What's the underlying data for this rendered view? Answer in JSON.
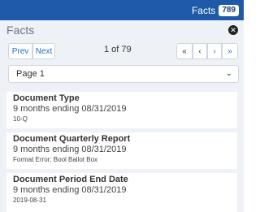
{
  "topbar": {
    "facts_label": "Facts",
    "facts_count": "789"
  },
  "panel": {
    "title": "Facts",
    "prev_label": "Prev",
    "next_label": "Next",
    "page_counter": "1 of 79",
    "nav_first": "«",
    "nav_prev": "‹",
    "nav_next": "›",
    "nav_last": "»",
    "page_select": "Page 1"
  },
  "facts": [
    {
      "name": "Document Type",
      "period": "9 months ending 08/31/2019",
      "value": "10-Q"
    },
    {
      "name": "Document Quarterly Report",
      "period": "9 months ending 08/31/2019",
      "value": "Format Error: Bool Ballot Box"
    },
    {
      "name": "Document Period End Date",
      "period": "9 months ending 08/31/2019",
      "value": "2019-08-31"
    }
  ],
  "icons": {
    "close": "close-icon",
    "chevron": "chevron-down-icon"
  },
  "colors": {
    "topbar": "#1f5aa8",
    "link": "#1f6fd0",
    "panel_bg": "#eef1f5"
  }
}
